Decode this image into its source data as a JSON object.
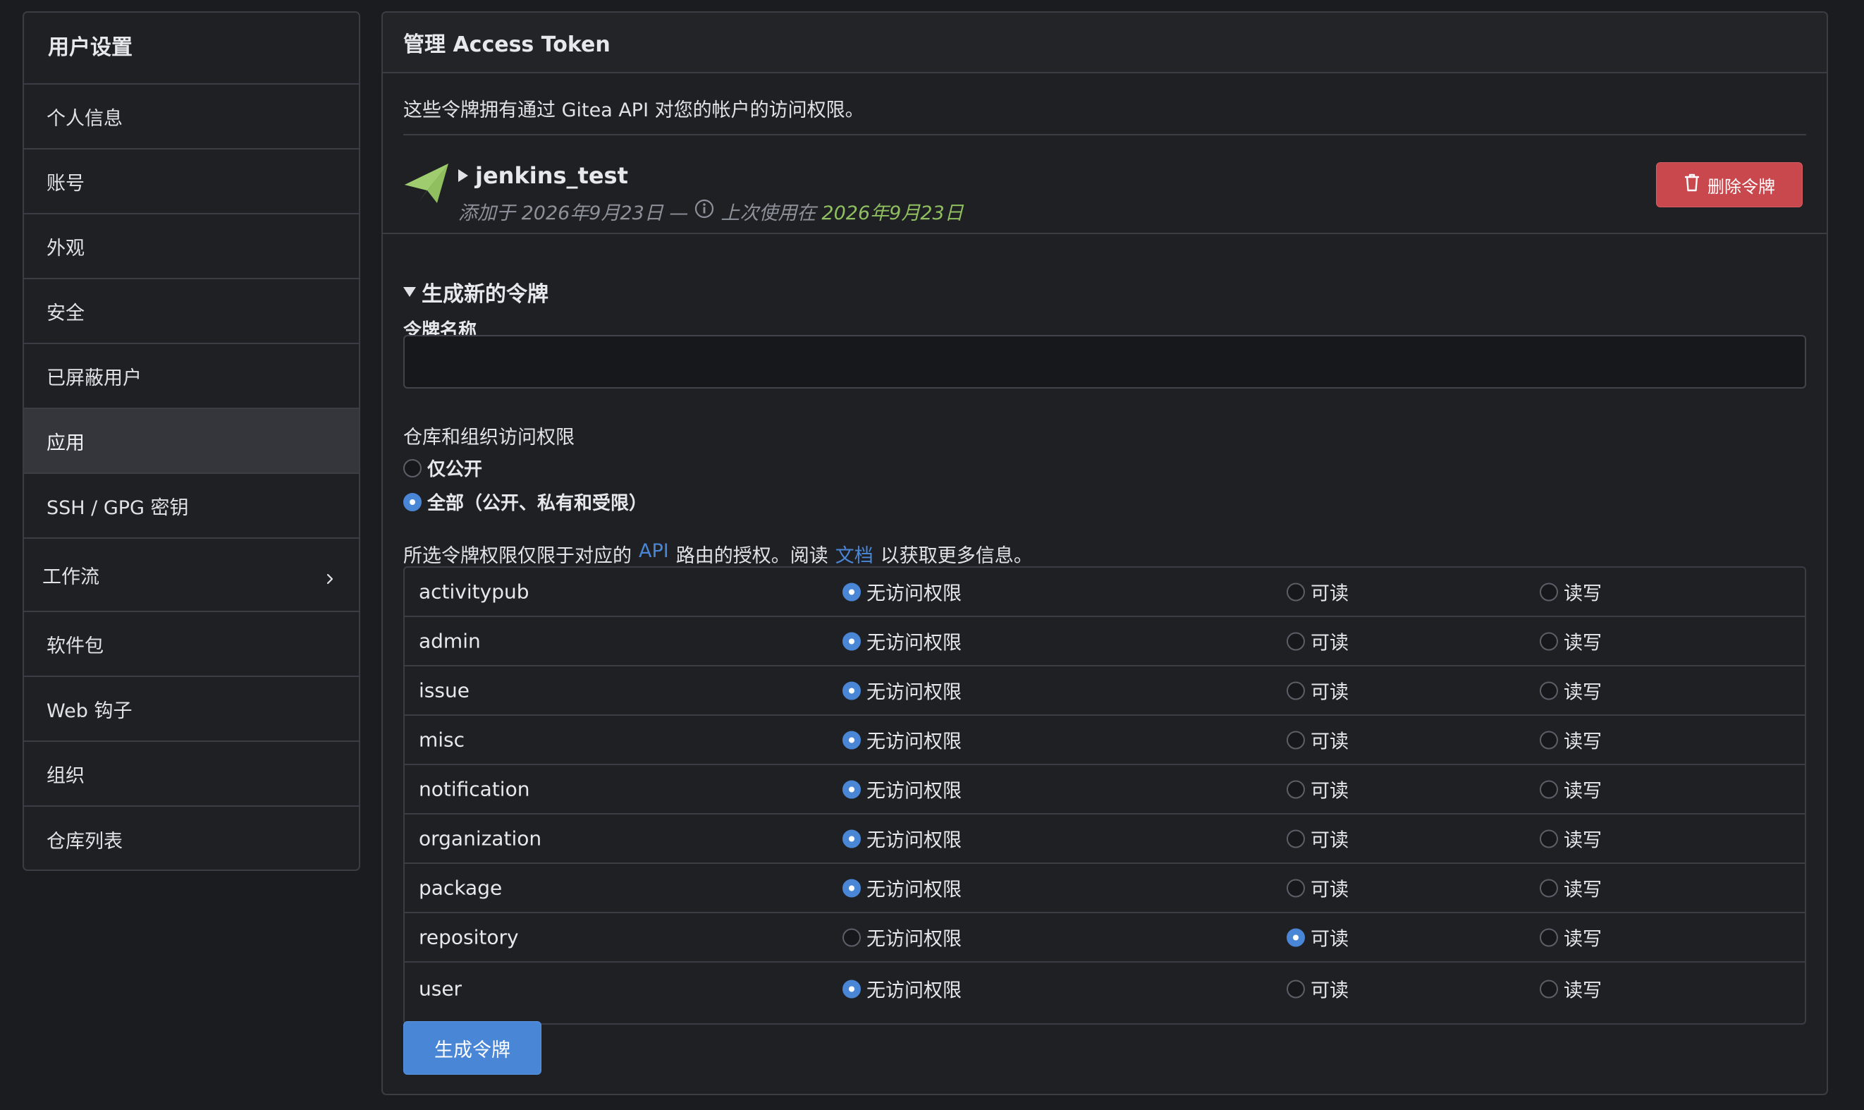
{
  "sidebar": {
    "title": "用户设置",
    "items": [
      {
        "label": "个人信息"
      },
      {
        "label": "账号"
      },
      {
        "label": "外观"
      },
      {
        "label": "安全"
      },
      {
        "label": "已屏蔽用户"
      },
      {
        "label": "应用",
        "active": true
      },
      {
        "label": "SSH / GPG 密钥"
      },
      {
        "label": "工作流",
        "has_chevron": true
      },
      {
        "label": "软件包"
      },
      {
        "label": "Web 钩子"
      },
      {
        "label": "组织"
      },
      {
        "label": "仓库列表"
      }
    ]
  },
  "main": {
    "title": "管理 Access Token",
    "description": "这些令牌拥有通过 Gitea API 对您的帐户的访问权限。",
    "token": {
      "name": "jenkins_test",
      "added_prefix": "添加于 2026年9月23日 —",
      "last_used_prefix": "上次使用在",
      "last_used_date": "2026年9月23日",
      "delete_label": "删除令牌"
    },
    "generate": {
      "section_title": "生成新的令牌",
      "name_label": "令牌名称",
      "name_value": "",
      "scope_label": "仓库和组织访问权限",
      "scope_options": [
        {
          "label": "仅公开",
          "selected": false
        },
        {
          "label": "全部（公开、私有和受限）",
          "selected": true
        }
      ],
      "perm_note_before": "所选令牌权限仅限于对应的",
      "perm_note_api": "API",
      "perm_note_middle": "路由的授权。阅读",
      "perm_note_docs": "文档",
      "perm_note_after": "以获取更多信息。",
      "option_labels": {
        "none": "无访问权限",
        "read": "可读",
        "readwrite": "读写"
      },
      "permissions": [
        {
          "name": "activitypub",
          "selected": "none"
        },
        {
          "name": "admin",
          "selected": "none"
        },
        {
          "name": "issue",
          "selected": "none"
        },
        {
          "name": "misc",
          "selected": "none"
        },
        {
          "name": "notification",
          "selected": "none"
        },
        {
          "name": "organization",
          "selected": "none"
        },
        {
          "name": "package",
          "selected": "none"
        },
        {
          "name": "repository",
          "selected": "read"
        },
        {
          "name": "user",
          "selected": "none"
        }
      ],
      "submit_label": "生成令牌"
    }
  },
  "colors": {
    "accent": "#4a86d6",
    "danger": "#c8484d",
    "success_text": "#8fbf5f",
    "token_icon": "#8fbf5f"
  }
}
